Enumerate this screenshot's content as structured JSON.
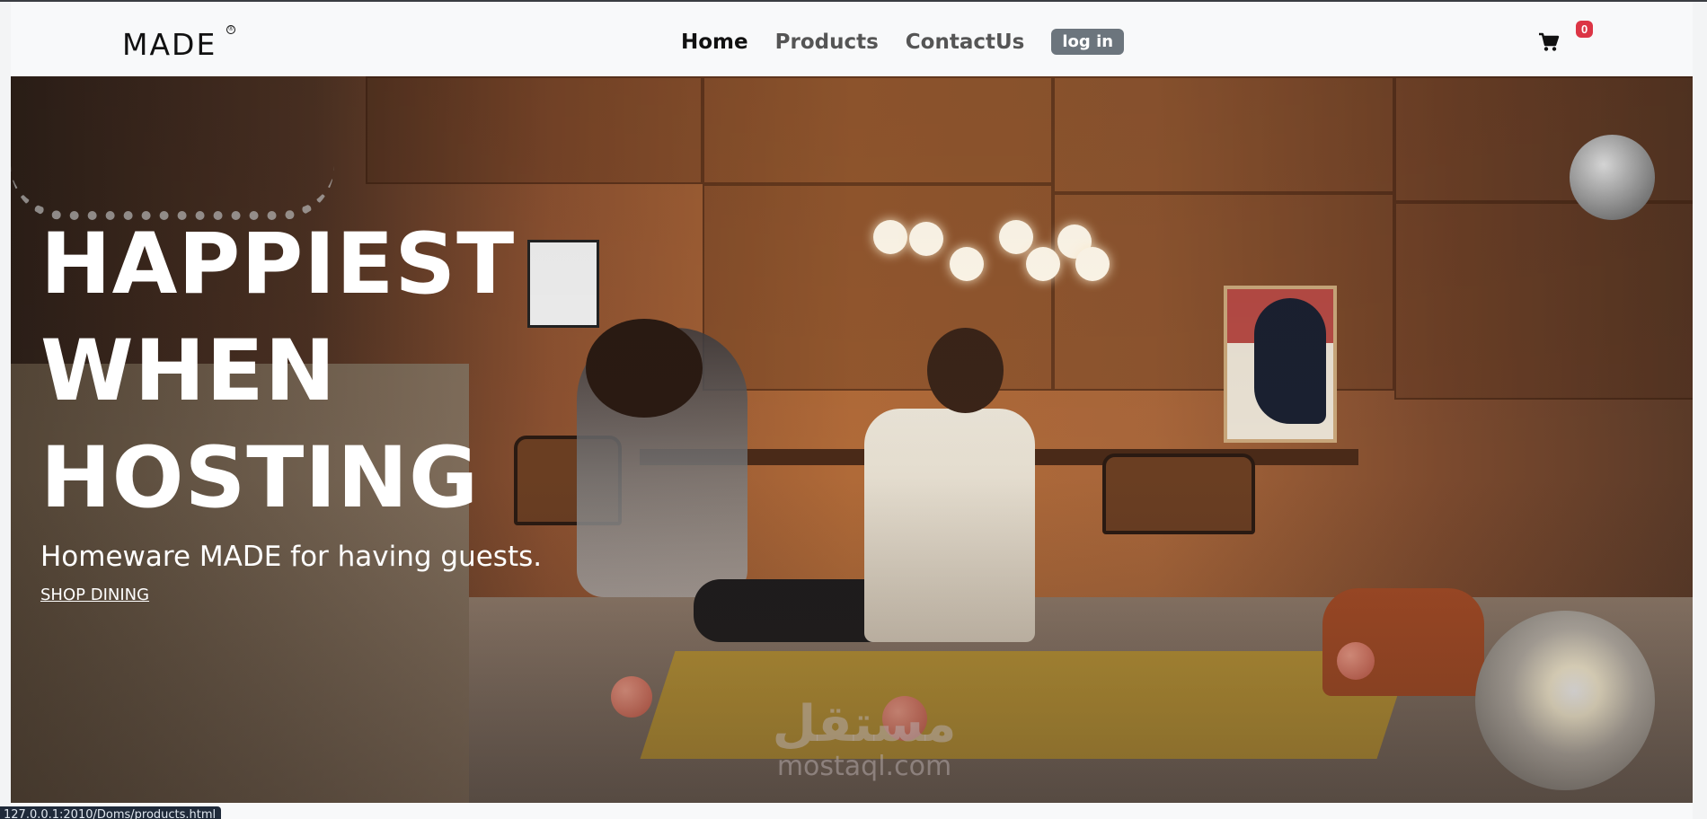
{
  "brand": {
    "logo_text": "MADE",
    "logo_mark": "®"
  },
  "nav": {
    "links": [
      {
        "label": "Home",
        "active": true
      },
      {
        "label": "Products",
        "active": false
      },
      {
        "label": "ContactUs",
        "active": false
      }
    ],
    "login_label": "log in",
    "cart_icon": "cart-icon",
    "cart_count": "0"
  },
  "hero": {
    "headline_lines": [
      "HAPPIEST",
      "WHEN",
      "HOSTING"
    ],
    "subhead": "Homeware MADE for having guests.",
    "cta_label": "SHOP DINING"
  },
  "watermark": {
    "arabic": "مستقل",
    "latin": "mostaql.com"
  },
  "status_bar": {
    "url": "127.0.0.1:2010/Doms/products.html"
  },
  "colors": {
    "navbar_bg": "#f8f9fa",
    "login_bg": "#6c757d",
    "badge_bg": "#dc3545",
    "hero_text": "#ffffff"
  }
}
